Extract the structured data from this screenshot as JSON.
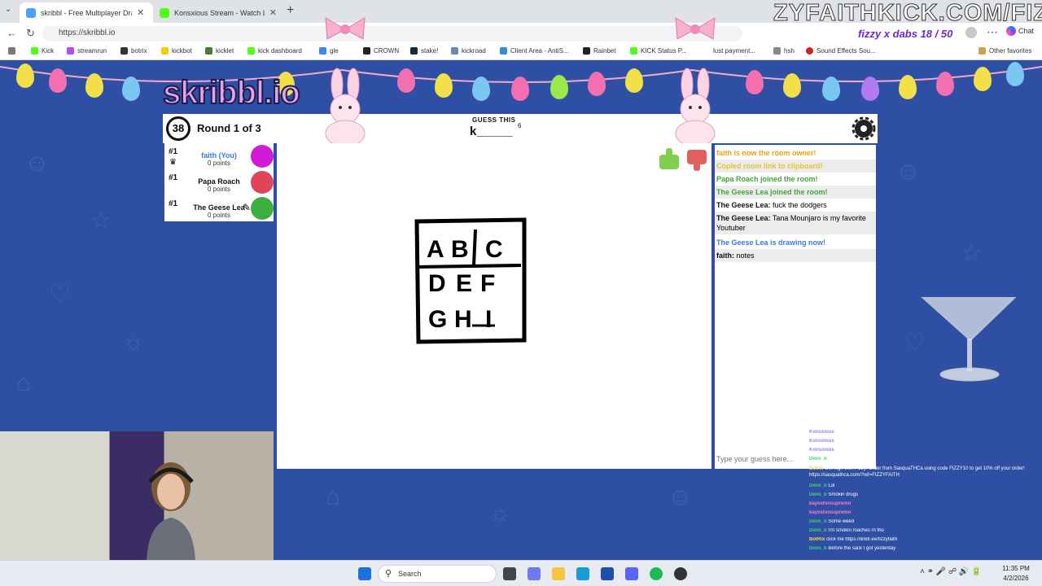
{
  "browser": {
    "tabs": [
      {
        "title": "skribbl - Free Multiplayer Drawing",
        "active": true
      },
      {
        "title": "Konsxious Stream - Watch Live",
        "active": false
      }
    ],
    "url": "https://skribbl.io",
    "profile_text": "fizzy x dabs 18 / 50",
    "copilot_label": "Chat",
    "bookmarks": [
      "Kick",
      "streamrun",
      "botrix",
      "kickbot",
      "kicklet",
      "kick dashboard",
      "gle",
      "CROWN",
      "stake!",
      "kickroad",
      "Client Area - AntiS...",
      "Rainbet",
      "KICK Status P...",
      "lust payment...",
      "hsh",
      "Sound Effects Sou..."
    ],
    "other_favorites": "Other favorites"
  },
  "stream_banner": "ZYFAITHKICK.COM/FIZ",
  "game": {
    "logo": "skribbl.io",
    "timer": "38",
    "round": "Round 1 of 3",
    "guess_label": "GUESS THIS",
    "word_hint": "k_____",
    "word_length": "6",
    "players": [
      {
        "rank": "#1",
        "name": "faith (You)",
        "points": "0 points",
        "color": "#d21bd8",
        "is_owner": true
      },
      {
        "rank": "#1",
        "name": "Papa Roach",
        "points": "0 points",
        "color": "#e0445a",
        "is_owner": false
      },
      {
        "rank": "#1",
        "name": "The Geese Lea",
        "points": "0 points",
        "color": "#3bb03b",
        "is_owner": false
      }
    ],
    "drawing_letters": [
      [
        "A",
        "B",
        "C"
      ],
      [
        "D",
        "E",
        "F"
      ],
      [
        "G",
        "H",
        "I"
      ]
    ],
    "chat": [
      {
        "user": "",
        "text": "faith is now the room owner!",
        "color": "#e8a21c"
      },
      {
        "user": "",
        "text": "Copied room link to clipboard!",
        "color": "#e3c52a"
      },
      {
        "user": "",
        "text": "Papa Roach joined the room!",
        "color": "#3ea832"
      },
      {
        "user": "",
        "text": "The Geese Lea joined the room!",
        "color": "#3ea832"
      },
      {
        "user": "The Geese Lea:",
        "text": "fuck the dodgers",
        "color": "#111111"
      },
      {
        "user": "The Geese Lea:",
        "text": "Tana Mounjaro is my favorite Youtuber",
        "color": "#111111"
      },
      {
        "user": "",
        "text": "The Geese Lea is drawing now!",
        "color": "#3d79d6"
      },
      {
        "user": "faith:",
        "text": "notes",
        "color": "#111111"
      }
    ],
    "guess_placeholder": "Type your guess here..."
  },
  "overlay_chat": [
    {
      "user": "Konsxious",
      "text": "",
      "color": "#9c7bff"
    },
    {
      "user": "Konsxious",
      "text": "",
      "color": "#9c7bff"
    },
    {
      "user": "Konsxious",
      "text": "",
      "color": "#9c7bff"
    },
    {
      "user": "Devo_b",
      "text": "",
      "color": "#39d96d"
    },
    {
      "user": "Botrix",
      "text": "Get high with Fizzy! Order from SasquaTHCa using code FIZZY10 to get 10% off your order! https://sasquathca.com/?ref=FIZZYFAITH",
      "color": "#ffd34d"
    },
    {
      "user": "Devo_b",
      "text": "Lol",
      "color": "#39d96d"
    },
    {
      "user": "Devo_b",
      "text": "Smokin drugs",
      "color": "#39d96d"
    },
    {
      "user": "kayoshinsupremo",
      "text": "",
      "color": "#ff7ad1"
    },
    {
      "user": "kayoshinsupremo",
      "text": "",
      "color": "#ff7ad1"
    },
    {
      "user": "Devo_b",
      "text": "Some weed",
      "color": "#39d96d"
    },
    {
      "user": "Devo_b",
      "text": "I'm smokin roaches rn tho",
      "color": "#39d96d"
    },
    {
      "user": "BotRix",
      "text": "click me https://linktr.ee/fizzyfaith",
      "color": "#ffd34d"
    },
    {
      "user": "Devo_b",
      "text": "Before the sack I got yesterday",
      "color": "#39d96d"
    }
  ],
  "taskbar": {
    "search_label": "Search",
    "time": "11:35 PM",
    "date": "4/2/2026"
  }
}
